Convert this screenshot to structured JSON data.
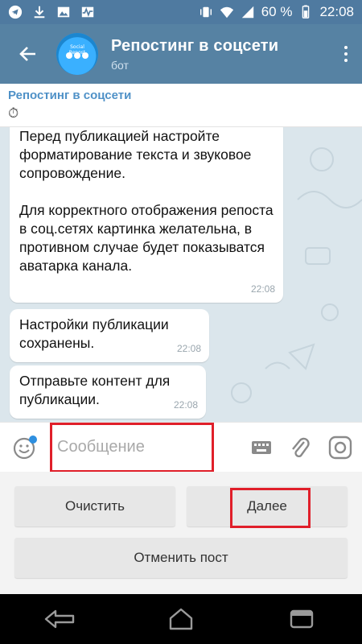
{
  "status_bar": {
    "battery": "60 %",
    "time": "22:08",
    "icons": [
      "telegram-icon",
      "download-icon",
      "image-icon",
      "activity-icon",
      "vibrate-icon",
      "wifi-icon",
      "signal-icon",
      "battery-icon"
    ]
  },
  "header": {
    "title": "Репостинг в соцсети",
    "subtitle": "бот",
    "avatar_text": "Social Repost"
  },
  "pinned": {
    "title": "Репостинг в соцсети",
    "icon": "⏱"
  },
  "messages": [
    {
      "text": "Перед публикацией настройте форматирование текста и звуковое сопровождение.\n\nДля корректного отображения репоста в соц.сетях картинка желательна, в противном случае будет показыватся аватарка канала.",
      "time": "22:08"
    },
    {
      "text": "Настройки публикации сохранены.",
      "time": "22:08"
    },
    {
      "text": "Отправьте контент для публикации.",
      "time": "22:08"
    }
  ],
  "input": {
    "placeholder": "Сообщение"
  },
  "keyboard": {
    "clear_label": "Очистить",
    "next_label": "Далее",
    "cancel_label": "Отменить пост"
  },
  "colors": {
    "header": "#5682a3",
    "status_bar": "#4f7aa0",
    "chat_bg": "#dbe6ec",
    "highlight": "#e01f2a",
    "accent": "#4f91c7"
  }
}
